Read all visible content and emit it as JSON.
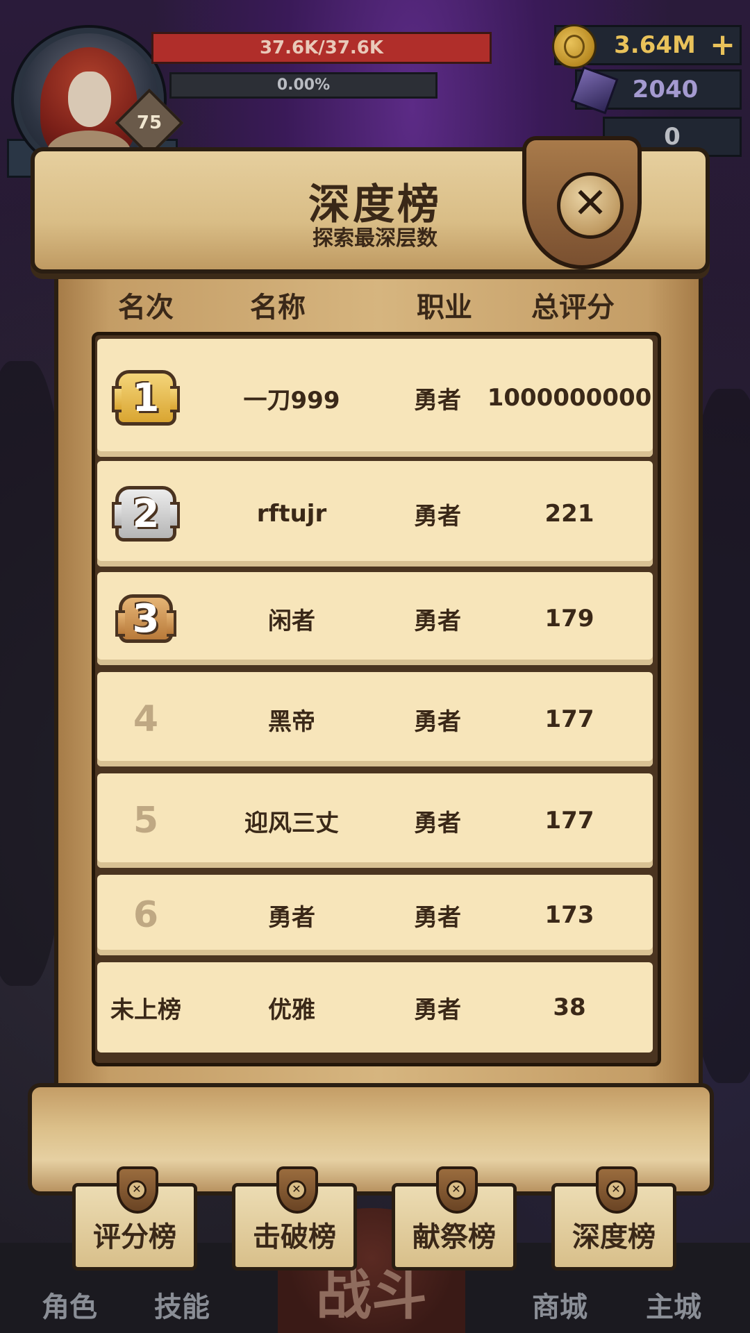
{
  "hud": {
    "hp_text": "37.6K/37.6K",
    "xp_text": "0.00%",
    "level": "75",
    "gold": "3.64M",
    "gems": "2040",
    "tokens": "0",
    "add_label": "+",
    "icons": {
      "gold": "gold-coin-icon",
      "gems": "crystal-gem-icon"
    }
  },
  "panel": {
    "title": "深度榜",
    "subtitle": "探索最深层数",
    "close_label": "✕",
    "columns": [
      "名次",
      "名称",
      "职业",
      "总评分"
    ],
    "rows": [
      {
        "rank": "1",
        "medal": "gold",
        "name": "一刀999",
        "class": "勇者",
        "score": "1000000000"
      },
      {
        "rank": "2",
        "medal": "silver",
        "name": "rftujr",
        "class": "勇者",
        "score": "221"
      },
      {
        "rank": "3",
        "medal": "bronze",
        "name": "闲者",
        "class": "勇者",
        "score": "179"
      },
      {
        "rank": "4",
        "name": "黑帝",
        "class": "勇者",
        "score": "177"
      },
      {
        "rank": "5",
        "name": "迎风三丈",
        "class": "勇者",
        "score": "177"
      },
      {
        "rank": "6",
        "name": "勇者",
        "class": "勇者",
        "score": "173"
      }
    ],
    "self_row": {
      "rank": "未上榜",
      "name": "优雅",
      "class": "勇者",
      "score": "38"
    }
  },
  "tabs": [
    "评分榜",
    "击破榜",
    "献祭榜",
    "深度榜"
  ],
  "nav": {
    "role": "角色",
    "skill": "技能",
    "fight": "战斗",
    "shop": "商城",
    "city": "主城"
  },
  "colors": {
    "parchment": "#f7e5ba",
    "text": "#3a2818",
    "hp": "#b02e2a"
  }
}
